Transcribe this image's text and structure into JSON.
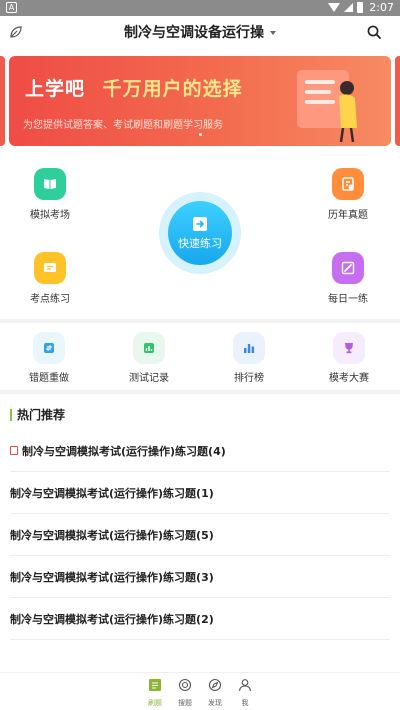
{
  "status_bar": {
    "time": "2:07"
  },
  "header": {
    "title": "制冷与空调设备运行操"
  },
  "banner": {
    "headline_part1": "上学吧",
    "headline_part2": "千万用户的选择",
    "subline": "为您提供试题答案、考试刷题和刷题学习服务"
  },
  "quick": {
    "center_label": "快速练习",
    "items": [
      {
        "label": "模拟考场",
        "color": "#2fcf9b"
      },
      {
        "label": "历年真题",
        "color": "#ff8d3a"
      },
      {
        "label": "考点练习",
        "color": "#ffc227"
      },
      {
        "label": "每日一练",
        "color": "#c56ef0"
      }
    ]
  },
  "tools": [
    {
      "label": "错题重做",
      "bg": "#eaf6fd",
      "fg": "#2fa3e6"
    },
    {
      "label": "测试记录",
      "bg": "#e9f8ee",
      "fg": "#33c06f"
    },
    {
      "label": "排行榜",
      "bg": "#eaf2fd",
      "fg": "#3f87e6"
    },
    {
      "label": "模考大赛",
      "bg": "#f6ecfc",
      "fg": "#b05fe3"
    }
  ],
  "hot": {
    "title": "热门推荐",
    "items": [
      "制冷与空调模拟考试(运行操作)练习题(4)",
      "制冷与空调模拟考试(运行操作)练习题(1)",
      "制冷与空调模拟考试(运行操作)练习题(5)",
      "制冷与空调模拟考试(运行操作)练习题(3)",
      "制冷与空调模拟考试(运行操作)练习题(2)"
    ]
  },
  "bottom_nav": {
    "items": [
      {
        "label": "刷题",
        "active": true
      },
      {
        "label": "搜题",
        "active": false
      },
      {
        "label": "发现",
        "active": false
      },
      {
        "label": "我",
        "active": false
      }
    ]
  }
}
